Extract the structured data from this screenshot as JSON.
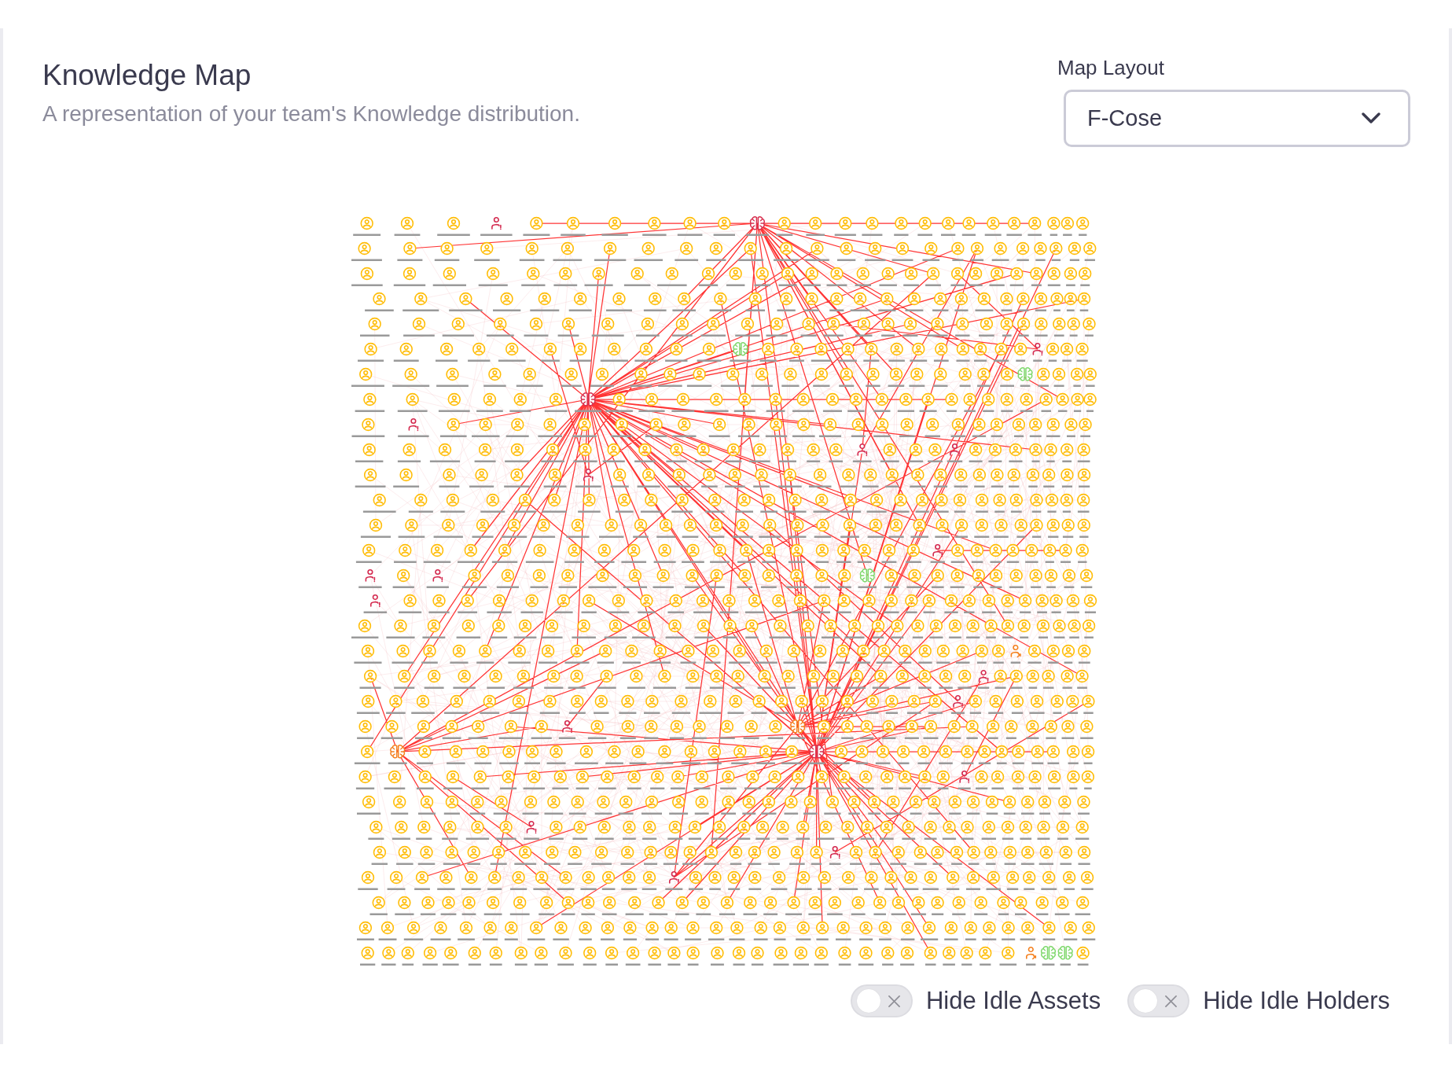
{
  "header": {
    "title": "Knowledge Map",
    "subtitle": "A representation of your team's Knowledge distribution."
  },
  "layout_select": {
    "label": "Map Layout",
    "value": "F-Cose"
  },
  "toggles": [
    {
      "label": "Hide Idle Assets",
      "on": false
    },
    {
      "label": "Hide Idle Holders",
      "on": false
    }
  ]
}
